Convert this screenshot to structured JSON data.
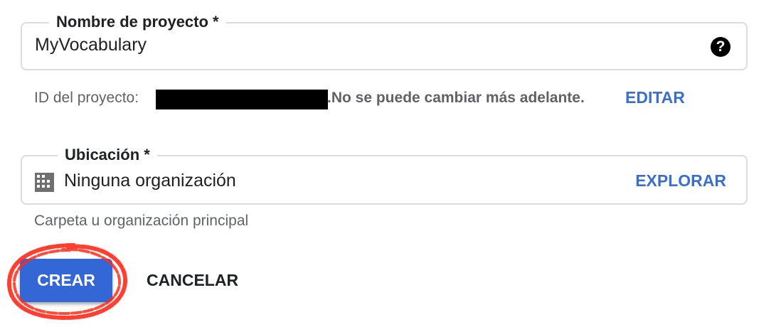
{
  "project_field": {
    "label": "Nombre de proyecto *",
    "value": "MyVocabulary",
    "help_icon": "help-circle-icon"
  },
  "project_id": {
    "prefix": "ID del proyecto:",
    "note": ".No se puede cambiar más adelante.",
    "edit_label": "EDITAR"
  },
  "location_field": {
    "label": "Ubicación *",
    "value": "Ninguna organización",
    "icon": "building-icon",
    "explore_label": "EXPLORAR",
    "hint": "Carpeta u organización principal"
  },
  "actions": {
    "create_label": "CREAR",
    "cancel_label": "CANCELAR"
  },
  "colors": {
    "primary": "#3367d6",
    "link": "#3b6fca",
    "highlight": "#ff2a1a"
  }
}
